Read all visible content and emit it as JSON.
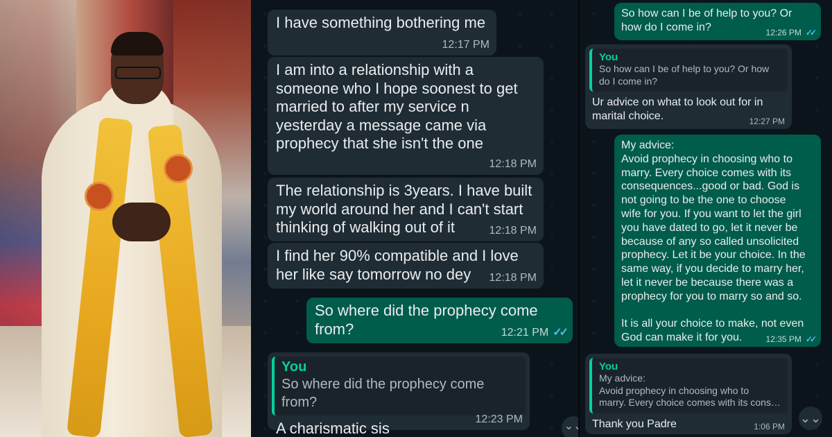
{
  "middle_chat": {
    "messages": [
      {
        "direction": "in",
        "text": "I have something bothering me",
        "time": "12:17 PM"
      },
      {
        "direction": "in",
        "text": "I am into a relationship with a\nsomeone who I hope soonest to get\nmarried to after my service n\nyesterday a message came via\nprophecy that she isn't the one",
        "time": "12:18 PM"
      },
      {
        "direction": "in",
        "text": "The relationship is 3years. I have built\nmy world around her and I can't start\nthinking of walking out of it",
        "time": "12:18 PM"
      },
      {
        "direction": "in",
        "text": "I find her 90% compatible and I love\nher like say tomorrow no dey",
        "time": "12:18 PM"
      },
      {
        "direction": "out",
        "text": "So where did the prophecy come\nfrom?",
        "time": "12:21 PM",
        "status": "read"
      },
      {
        "direction": "in",
        "quote_author": "You",
        "quote_text": "So where did the prophecy come from?",
        "text": "A charismatic sis",
        "time": "12:23 PM"
      }
    ]
  },
  "right_chat": {
    "messages": [
      {
        "direction": "out",
        "text": "So how can I be of help to you? Or\nhow do I come in?",
        "time": "12:26 PM",
        "status": "read"
      },
      {
        "direction": "in",
        "quote_author": "You",
        "quote_text": "So how can I be of help to you? Or how\ndo I come in?",
        "text": "Ur advice on what to look out for in\nmarital choice.",
        "time": "12:27 PM"
      },
      {
        "direction": "out",
        "text": "My advice:\nAvoid prophecy in choosing who to\nmarry. Every choice comes with its\nconsequences...good or bad. God is\nnot going to be the one to choose\nwife for you. If you want to let the girl\nyou have dated to go, let it never be\nbecause of any so called unsolicited\nprophecy. Let it be your choice. In the\nsame way, if you decide to marry her,\nlet it never be because there was a\nprophecy for you to marry so and so.\n\nIt is all your choice to make, not even\nGod can make it for you.",
        "time": "12:35 PM",
        "status": "read"
      },
      {
        "direction": "in",
        "quote_author": "You",
        "quote_text": "My advice:\nAvoid prophecy in choosing who to\nmarry. Every choice comes with its cons…",
        "text": "Thank you Padre",
        "time": "1:06 PM"
      }
    ]
  },
  "icons": {
    "read_ticks": "✓✓",
    "scroll_down": "⌄⌄"
  },
  "colors": {
    "background": "#0b141a",
    "incoming": "#202c33",
    "outgoing": "#005c4b",
    "accent": "#06cf9c",
    "read_tick": "#53bdeb"
  }
}
